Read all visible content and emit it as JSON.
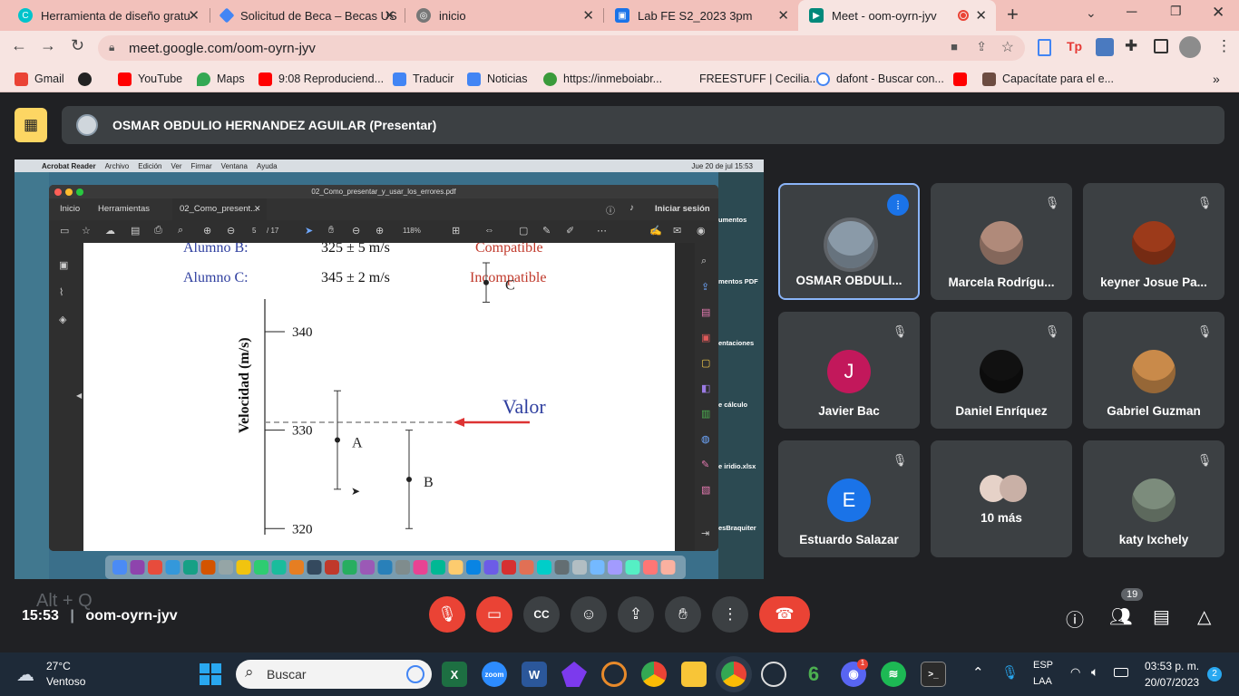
{
  "browser": {
    "tabs": [
      {
        "title": "Herramienta de diseño gratu",
        "color": "#00c4cc"
      },
      {
        "title": "Solicitud de Beca – Becas US",
        "color": "#4285f4"
      },
      {
        "title": "inicio",
        "color": "#777777"
      },
      {
        "title": "Lab FE S2_2023 3pm",
        "color": "#1a73e8"
      },
      {
        "title": "Meet - oom-oyrn-jyv",
        "color": "#00897b"
      }
    ],
    "new_tab": "+",
    "url": "meet.google.com/oom-oyrn-jyv",
    "bookmarks": [
      {
        "label": "Gmail",
        "color": "#ea4335"
      },
      {
        "label": "",
        "color": "#222222"
      },
      {
        "label": "YouTube",
        "color": "#ff0000"
      },
      {
        "label": "Maps",
        "color": "#34a853"
      },
      {
        "label": "9:08 Reproduciend...",
        "color": "#ff0000"
      },
      {
        "label": "Traducir",
        "color": "#4285f4"
      },
      {
        "label": "Noticias",
        "color": "#4285f4"
      },
      {
        "label": "https://inmeboiabr...",
        "color": "#3a9a3a"
      },
      {
        "label": "FREESTUFF | Cecilia...",
        "color": "#f7e4e1"
      },
      {
        "label": "dafont - Buscar con...",
        "color": "#4285f4"
      },
      {
        "label": "",
        "color": "#ff0000"
      },
      {
        "label": "Capacítate para el e...",
        "color": "#6d4c41"
      }
    ]
  },
  "meet": {
    "presenter_name": "OSMAR OBDULIO HERNANDEZ AGUILAR (Presentar)",
    "time": "15:53",
    "meeting_code": "oom-oyrn-jyv",
    "people_count": "19",
    "shortcut_hint": "Alt + Q",
    "tiles": [
      {
        "name": "OSMAR OBDULI...",
        "avatar": "photo",
        "avatar_color": "#8a9aa8",
        "speaking": true
      },
      {
        "name": "Marcela Rodrígu...",
        "avatar": "photo",
        "avatar_color": "#b08a7a",
        "speaking": false
      },
      {
        "name": "keyner Josue Pa...",
        "avatar": "photo",
        "avatar_color": "#9c3a1a",
        "speaking": false
      },
      {
        "name": "Javier Bac",
        "avatar": "J",
        "avatar_color": "#c2185b",
        "speaking": false
      },
      {
        "name": "Daniel Enríquez",
        "avatar": "photo",
        "avatar_color": "#111111",
        "speaking": false
      },
      {
        "name": "Gabriel Guzman",
        "avatar": "photo",
        "avatar_color": "#c98a4a",
        "speaking": false
      },
      {
        "name": "Estuardo Salazar",
        "avatar": "E",
        "avatar_color": "#1a73e8",
        "speaking": false
      },
      {
        "name": "10 más",
        "avatar": "group",
        "avatar_color": "#d9c1b8",
        "speaking": false
      },
      {
        "name": "katy Ixchely",
        "avatar": "photo",
        "avatar_color": "#7c8c7c",
        "speaking": false
      }
    ]
  },
  "shared_screen": {
    "mac_menu": [
      "Acrobat Reader",
      "Archivo",
      "Edición",
      "Ver",
      "Firmar",
      "Ventana",
      "Ayuda"
    ],
    "mac_clock": "Jue 20 de jul  15:53",
    "desktop_labels": [
      "umentos",
      "mentos PDF",
      "entaciones",
      "e cálculo",
      "e iridio.xlsx",
      "esBraquiter"
    ],
    "acrobat": {
      "file_title": "02_Como_presentar_y_usar_los_errores.pdf",
      "tabs": [
        "Inicio",
        "Herramientas",
        "02_Como_present..."
      ],
      "signin": "Iniciar sesión",
      "page": "5",
      "page_total": "/ 17",
      "zoom": "118%"
    },
    "pdf": {
      "rows": [
        {
          "student": "Alumno B:",
          "value": "325 ± 5 m/s",
          "status": "Compatible"
        },
        {
          "student": "Alumno C:",
          "value": "345 ± 2 m/s",
          "status": "Incompatible"
        }
      ],
      "ylabel": "Velocidad   (m/s)",
      "ticks": [
        "340",
        "330",
        "320"
      ],
      "point_labels": [
        "A",
        "B",
        "C"
      ],
      "arrow_label": "Valor"
    }
  },
  "chart_data": {
    "type": "scatter",
    "title": "",
    "xlabel": "",
    "ylabel": "Velocidad   (m/s)",
    "ylim": [
      318,
      347
    ],
    "yticks": [
      340,
      330,
      320
    ],
    "reference_line": {
      "label": "Valor",
      "y": 330.8
    },
    "series": [
      {
        "name": "A",
        "points": [
          {
            "y": 329,
            "err": 5
          }
        ]
      },
      {
        "name": "B",
        "points": [
          {
            "y": 325,
            "err": 5
          }
        ]
      },
      {
        "name": "C",
        "points": [
          {
            "y": 345,
            "err": 2
          }
        ]
      }
    ]
  },
  "taskbar": {
    "weather_temp": "27°C",
    "weather_desc": "Ventoso",
    "search_placeholder": "Buscar",
    "lang": "ESP",
    "lang2": "LAA",
    "clock_time": "03:53 p. m.",
    "clock_date": "20/07/2023",
    "notif_count": "2"
  }
}
